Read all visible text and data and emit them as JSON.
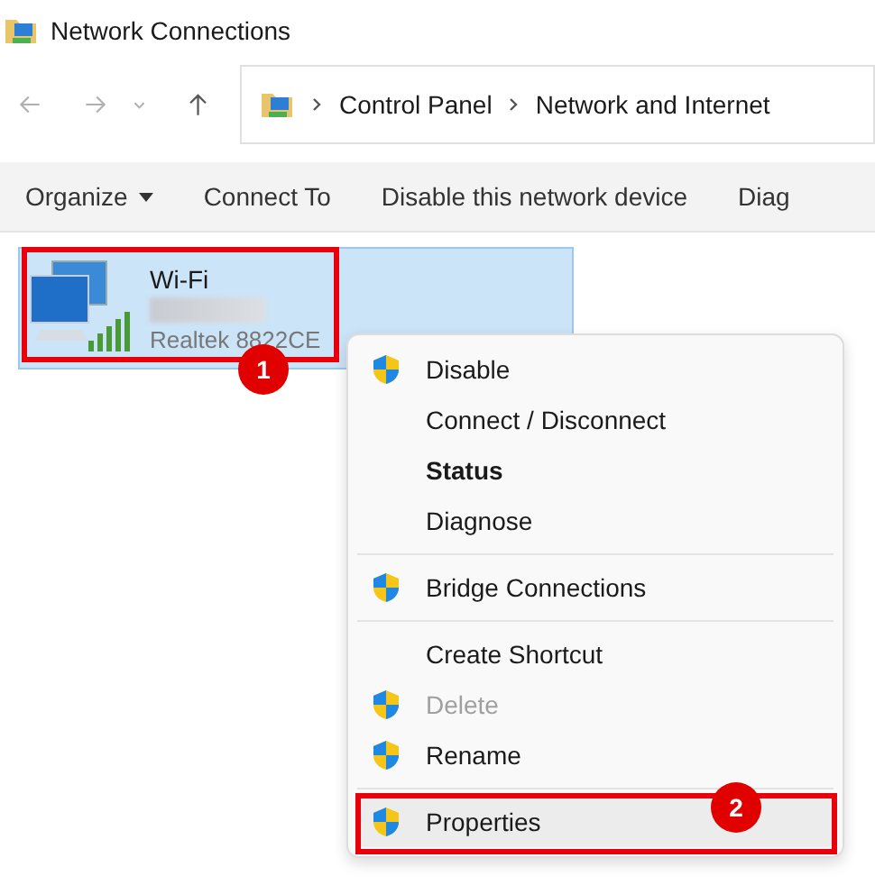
{
  "window": {
    "title": "Network Connections"
  },
  "navigation": {
    "breadcrumb": [
      "Control Panel",
      "Network and Internet"
    ]
  },
  "toolbar": [
    {
      "label": "Organize",
      "dropdown": true
    },
    {
      "label": "Connect To",
      "dropdown": false
    },
    {
      "label": "Disable this network device",
      "dropdown": false
    },
    {
      "label": "Diag",
      "dropdown": false
    }
  ],
  "connections": [
    {
      "name": "Wi-Fi",
      "adapter": "Realtek 8822CE",
      "selected": true,
      "annotation": "1"
    }
  ],
  "context_menu": [
    {
      "kind": "item",
      "label": "Disable",
      "shield": true,
      "bold": false,
      "disabled": false,
      "highlighted": false
    },
    {
      "kind": "item",
      "label": "Connect / Disconnect",
      "shield": false,
      "bold": false,
      "disabled": false,
      "highlighted": false
    },
    {
      "kind": "item",
      "label": "Status",
      "shield": false,
      "bold": true,
      "disabled": false,
      "highlighted": false
    },
    {
      "kind": "item",
      "label": "Diagnose",
      "shield": false,
      "bold": false,
      "disabled": false,
      "highlighted": false
    },
    {
      "kind": "separator"
    },
    {
      "kind": "item",
      "label": "Bridge Connections",
      "shield": true,
      "bold": false,
      "disabled": false,
      "highlighted": false
    },
    {
      "kind": "separator"
    },
    {
      "kind": "item",
      "label": "Create Shortcut",
      "shield": false,
      "bold": false,
      "disabled": false,
      "highlighted": false
    },
    {
      "kind": "item",
      "label": "Delete",
      "shield": true,
      "bold": false,
      "disabled": true,
      "highlighted": false
    },
    {
      "kind": "item",
      "label": "Rename",
      "shield": true,
      "bold": false,
      "disabled": false,
      "highlighted": false
    },
    {
      "kind": "separator"
    },
    {
      "kind": "item",
      "label": "Properties",
      "shield": true,
      "bold": false,
      "disabled": false,
      "highlighted": true,
      "annotation": "2"
    }
  ]
}
